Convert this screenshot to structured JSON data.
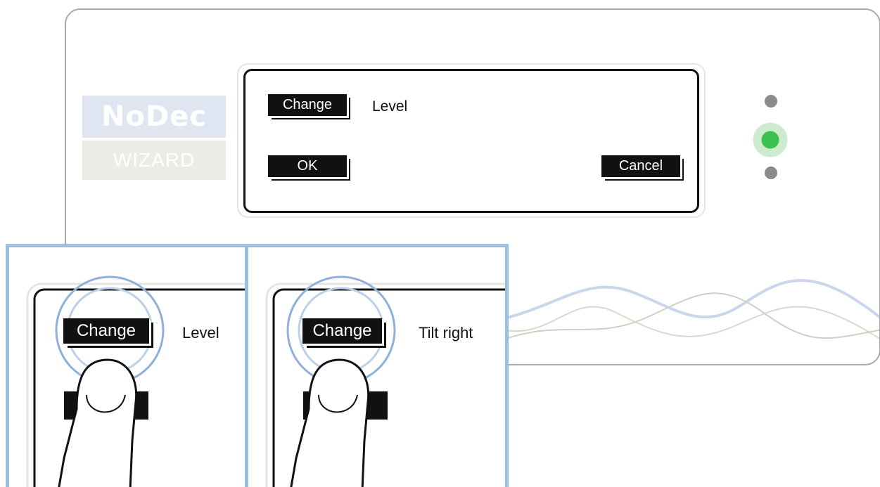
{
  "logo": {
    "brand": "NoDec",
    "sub": "WIZARD"
  },
  "screen": {
    "change_label": "Change",
    "setting": "Level",
    "ok_label": "OK",
    "cancel_label": "Cancel"
  },
  "leds": [
    {
      "name": "led-top",
      "color": "#8a8a8a",
      "state": "off"
    },
    {
      "name": "led-middle",
      "color": "#3cc14e",
      "state": "on"
    },
    {
      "name": "led-bottom",
      "color": "#8a8a8a",
      "state": "off"
    }
  ],
  "steps": [
    {
      "change_label": "Change",
      "setting": "Level"
    },
    {
      "change_label": "Change",
      "setting": "Tilt right"
    }
  ]
}
